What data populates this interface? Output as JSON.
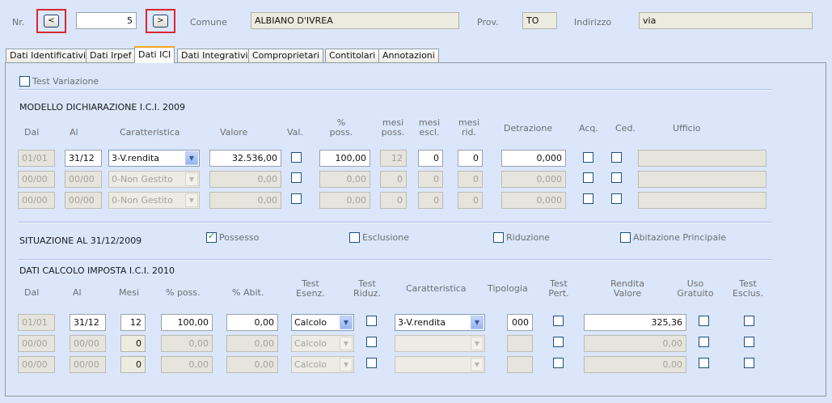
{
  "header": {
    "nr_label": "Nr.",
    "nr_value": "5",
    "prev_symbol": "<",
    "next_symbol": ">",
    "comune_label": "Comune",
    "comune_value": "ALBIANO D'IVREA",
    "prov_label": "Prov.",
    "prov_value": "TO",
    "indirizzo_label": "Indirizzo",
    "indirizzo_value": "via"
  },
  "tabs": [
    "Dati Identificativi",
    "Dati Irpef",
    "Dati ICI",
    "Dati Integrativi",
    "Comproprietari",
    "Contitolari",
    "Annotazioni"
  ],
  "active_tab": "Dati ICI",
  "test_variazione_label": "Test Variazione",
  "ici2009": {
    "title": "MODELLO DICHIARAZIONE I.C.I. 2009",
    "headers": {
      "dal": "Dal",
      "al": "Al",
      "caratteristica": "Caratteristica",
      "valore": "Valore",
      "val": "Val.",
      "poss": "%\nposs.",
      "mesi_poss": "mesi\nposs.",
      "mesi_escl": "mesi\nescl.",
      "mesi_rid": "mesi\nrid.",
      "detrazione": "Detrazione",
      "acq": "Acq.",
      "ced": "Ced.",
      "ufficio": "Ufficio"
    },
    "rows": [
      {
        "dal": "01/01",
        "al": "31/12",
        "caratteristica": "3-V.rendita",
        "valore": "32.536,00",
        "poss": "100,00",
        "mesi_poss": "12",
        "mesi_escl": "0",
        "mesi_rid": "0",
        "detrazione": "0,000",
        "ufficio": ""
      },
      {
        "dal": "00/00",
        "al": "00/00",
        "caratteristica": "0-Non Gestito",
        "valore": "0,00",
        "poss": "0,00",
        "mesi_poss": "0",
        "mesi_escl": "0",
        "mesi_rid": "0",
        "detrazione": "0,000",
        "ufficio": ""
      },
      {
        "dal": "00/00",
        "al": "00/00",
        "caratteristica": "0-Non Gestito",
        "valore": "0,00",
        "poss": "0,00",
        "mesi_poss": "0",
        "mesi_escl": "0",
        "mesi_rid": "0",
        "detrazione": "0,000",
        "ufficio": ""
      }
    ]
  },
  "situazione": {
    "title": "SITUAZIONE AL 31/12/2009",
    "possesso_label": "Possesso",
    "possesso_checked": true,
    "esclusione_label": "Esclusione",
    "riduzione_label": "Riduzione",
    "abitazione_label": "Abitazione Principale"
  },
  "calc2010": {
    "title": "DATI CALCOLO IMPOSTA I.C.I. 2010",
    "headers": {
      "dal": "Dal",
      "al": "Al",
      "mesi": "Mesi",
      "poss": "% poss.",
      "abit": "% Abit.",
      "test_esenz": "Test\nEsenz.",
      "test_riduz": "Test\nRiduz.",
      "caratteristica": "Caratteristica",
      "tipologia": "Tipologia",
      "test_pert": "Test\nPert.",
      "rendita_valore": "Rendita\nValore",
      "uso_gratuito": "Uso\nGratuito",
      "test_esclus": "Test\nEsclus."
    },
    "rows": [
      {
        "dal": "01/01",
        "al": "31/12",
        "mesi": "12",
        "poss": "100,00",
        "abit": "0,00",
        "test_esenz": "Calcolo",
        "caratteristica": "3-V.rendita",
        "tipologia": "000",
        "rendita_valore": "325,36"
      },
      {
        "dal": "00/00",
        "al": "00/00",
        "mesi": "0",
        "poss": "0,00",
        "abit": "0,00",
        "test_esenz": "Calcolo",
        "caratteristica": "",
        "tipologia": "",
        "rendita_valore": "0,00"
      },
      {
        "dal": "00/00",
        "al": "00/00",
        "mesi": "0",
        "poss": "0,00",
        "abit": "0,00",
        "test_esenz": "Calcolo",
        "caratteristica": "",
        "tipologia": "",
        "rendita_valore": "0,00"
      }
    ]
  },
  "icons": {
    "dropdown": "chevron-down-icon",
    "check": "check-icon"
  }
}
